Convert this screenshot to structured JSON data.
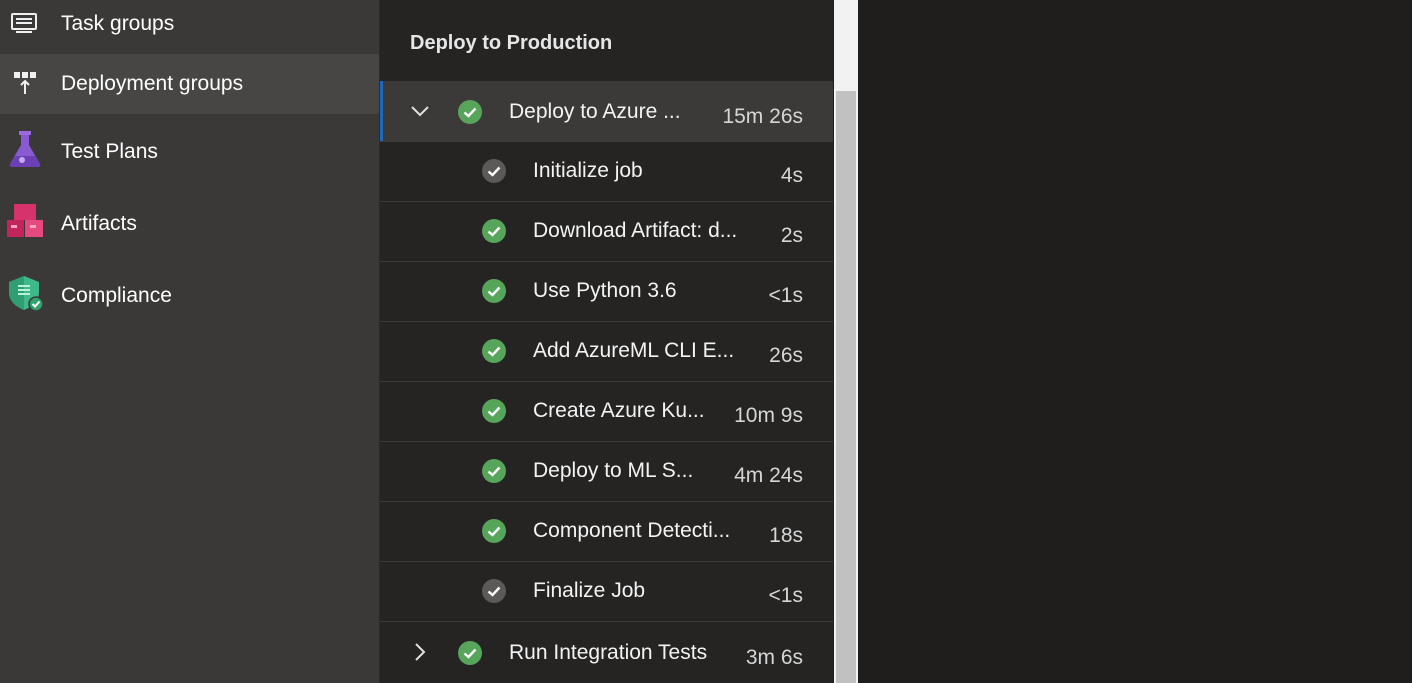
{
  "sidebar": {
    "items": [
      {
        "label": "Task groups",
        "icon": "task-groups-icon"
      },
      {
        "label": "Deployment groups",
        "icon": "deployment-groups-icon"
      },
      {
        "label": "Test Plans",
        "icon": "test-plans-icon"
      },
      {
        "label": "Artifacts",
        "icon": "artifacts-icon"
      },
      {
        "label": "Compliance",
        "icon": "compliance-icon"
      }
    ]
  },
  "panel": {
    "title": "Deploy to Production",
    "job": {
      "name": "Deploy to Azure ...",
      "duration": "15m 26s",
      "expanded": true,
      "status": "succeeded"
    },
    "steps": [
      {
        "name": "Initialize job",
        "duration": "4s",
        "status": "completed-gray"
      },
      {
        "name": "Download Artifact: d...",
        "duration": "2s",
        "status": "succeeded"
      },
      {
        "name": "Use Python 3.6",
        "duration": "<1s",
        "status": "succeeded"
      },
      {
        "name": "Add AzureML CLI E...",
        "duration": "26s",
        "status": "succeeded"
      },
      {
        "name": "Create Azure Ku...",
        "duration": "10m 9s",
        "status": "succeeded"
      },
      {
        "name": "Deploy to ML S...",
        "duration": "4m 24s",
        "status": "succeeded"
      },
      {
        "name": "Component Detecti...",
        "duration": "18s",
        "status": "succeeded"
      },
      {
        "name": "Finalize Job",
        "duration": "<1s",
        "status": "completed-gray"
      }
    ],
    "next_job": {
      "name": "Run Integration Tests",
      "duration": "3m 6s",
      "expanded": false,
      "status": "succeeded"
    }
  },
  "colors": {
    "success": "#57a55a",
    "neutral": "#5b5a59",
    "accent": "#1b6ac0"
  }
}
